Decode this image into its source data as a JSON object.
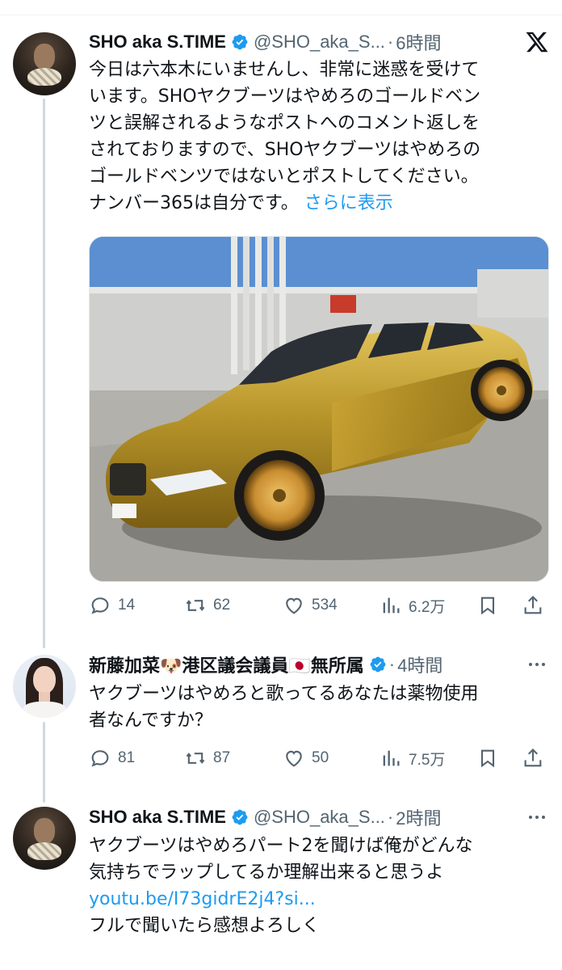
{
  "tweets": [
    {
      "display_name": "SHO aka S.TIME",
      "handle": "@SHO_aka_S...",
      "separator": "·",
      "time": "6時間",
      "lines": [
        "今日は六本木にいませんし、非常に迷惑を受けて",
        "います。SHOヤクブーツはやめろのゴールドベン",
        "ツと誤解されるようなポストへのコメント返しを",
        "されておりますので、SHOヤクブーツはやめろの",
        "ゴールドベンツではないとポストしてください。"
      ],
      "last_line": "ナンバー365は自分です。",
      "show_more": "さらに表示",
      "stats": {
        "replies": "14",
        "reposts": "62",
        "likes": "534",
        "views": "6.2万"
      }
    },
    {
      "display_name": "新藤加菜🐶港区議会議員🇯🇵無所属",
      "separator": "·",
      "time": "4時間",
      "lines": [
        "ヤクブーツはやめろと歌ってるあなたは薬物使用",
        "者なんですか？"
      ],
      "stats": {
        "replies": "81",
        "reposts": "87",
        "likes": "50",
        "views": "7.5万"
      }
    },
    {
      "display_name": "SHO aka S.TIME",
      "handle": "@SHO_aka_S...",
      "separator": "·",
      "time": "2時間",
      "lines": [
        "ヤクブーツはやめろパート2を聞けば俺がどんな",
        "気持ちでラップしてるか理解出来ると思うよ"
      ],
      "link": "youtu.be/I73gidrE2j4?si...",
      "after_link": "フルで聞いたら感想よろしく"
    }
  ],
  "colors": {
    "text": "#0f1419",
    "secondary": "#536471",
    "accent": "#1d9bf0",
    "gold": "#b8952a"
  },
  "icons": [
    "x-logo-icon",
    "verified-badge-icon",
    "reply-icon",
    "repost-icon",
    "like-icon",
    "views-icon",
    "bookmark-icon",
    "share-icon",
    "more-icon"
  ]
}
